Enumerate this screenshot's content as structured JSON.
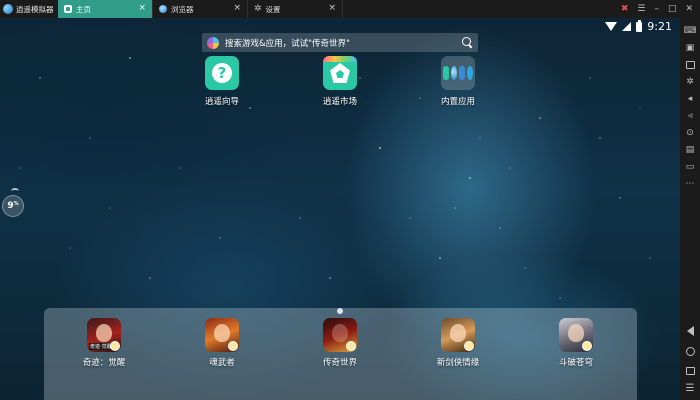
{
  "titlebar": {
    "app_name": "逍遥模拟器",
    "tabs": [
      {
        "label": "主页",
        "icon": "home-icon",
        "active": true
      },
      {
        "label": "浏览器",
        "icon": "browser-icon",
        "active": false
      },
      {
        "label": "设置",
        "icon": "gear-icon",
        "active": false
      }
    ],
    "close_glyph": "×",
    "accent_color": "#2f9d87"
  },
  "status_bar": {
    "time": "9:21"
  },
  "search": {
    "placeholder": "搜索游戏&应用，试试\"传奇世界\""
  },
  "desktop_apps": [
    {
      "label": "逍遥向导",
      "icon": "question-icon"
    },
    {
      "label": "逍遥市场",
      "icon": "market-icon"
    },
    {
      "label": "内置应用",
      "icon": "folder-icon"
    }
  ],
  "float_widget": {
    "label": "9",
    "unit": "%"
  },
  "dock": {
    "apps": [
      {
        "label": "奇迹：觉醒",
        "icon": "game-miracle-icon"
      },
      {
        "label": "魂武者",
        "icon": "game-hunwuzhe-icon"
      },
      {
        "label": "传奇世界",
        "icon": "game-chuanqi-icon"
      },
      {
        "label": "新剑侠情缘",
        "icon": "game-jianxia-icon"
      },
      {
        "label": "斗破苍穹",
        "icon": "game-doupo-icon"
      }
    ],
    "first_icon_tag": "奇迹·觉醒"
  },
  "sidebar": {
    "icons": [
      "keyboard-icon",
      "screenshot-icon",
      "window-icon",
      "settings-gear-icon",
      "volume-up-icon",
      "volume-down-icon",
      "location-icon",
      "apk-icon",
      "folder-icon",
      "more-icon"
    ],
    "nav": [
      "back-icon",
      "home-nav-icon",
      "recents-icon",
      "menu-icon"
    ]
  }
}
